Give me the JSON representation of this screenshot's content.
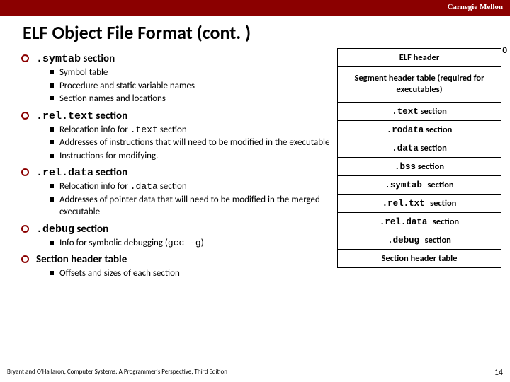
{
  "header": {
    "org": "Carnegie Mellon"
  },
  "title": "ELF Object File Format (cont. )",
  "bullets": [
    {
      "code": ".symtab",
      "tail": " section",
      "subs": [
        {
          "text": "Symbol table"
        },
        {
          "text": "Procedure and static variable names"
        },
        {
          "text": "Section names and locations"
        }
      ]
    },
    {
      "code": ".rel.text",
      "tail": " section",
      "subs": [
        {
          "pre": "Relocation info for ",
          "code": ".text",
          "post": " section"
        },
        {
          "text": "Addresses of instructions that will need to be modified in the executable"
        },
        {
          "text": "Instructions for modifying."
        }
      ]
    },
    {
      "code": ".rel.data",
      "tail": " section",
      "subs": [
        {
          "pre": "Relocation info for ",
          "code": ".data",
          "post": " section"
        },
        {
          "text": "Addresses of pointer data that will need to be modified in the merged executable"
        }
      ]
    },
    {
      "code": ".debug",
      "tail": " section",
      "subs": [
        {
          "pre": "Info for symbolic debugging (",
          "code": "gcc -g",
          "post": ")"
        }
      ]
    },
    {
      "plain": "Section header table",
      "subs": [
        {
          "text": "Offsets and sizes of each section"
        }
      ]
    }
  ],
  "diagram": {
    "zero": "0",
    "cells": [
      {
        "text": "ELF header"
      },
      {
        "text": "Segment header table (required for executables)",
        "tall": true
      },
      {
        "code": ".text",
        "tail": " section"
      },
      {
        "code": ".rodata",
        "tail": " section"
      },
      {
        "code": ".data",
        "tail": " section"
      },
      {
        "code": ".bss",
        "tail": " section"
      },
      {
        "code": ".symtab ",
        "tail": " section"
      },
      {
        "code": ".rel.txt ",
        "tail": " section"
      },
      {
        "code": ".rel.data ",
        "tail": " section"
      },
      {
        "code": ".debug ",
        "tail": " section"
      },
      {
        "text": "Section header table"
      }
    ]
  },
  "footer": {
    "left": "Bryant and O'Hallaron, Computer Systems: A Programmer's Perspective, Third Edition",
    "page": "14"
  }
}
